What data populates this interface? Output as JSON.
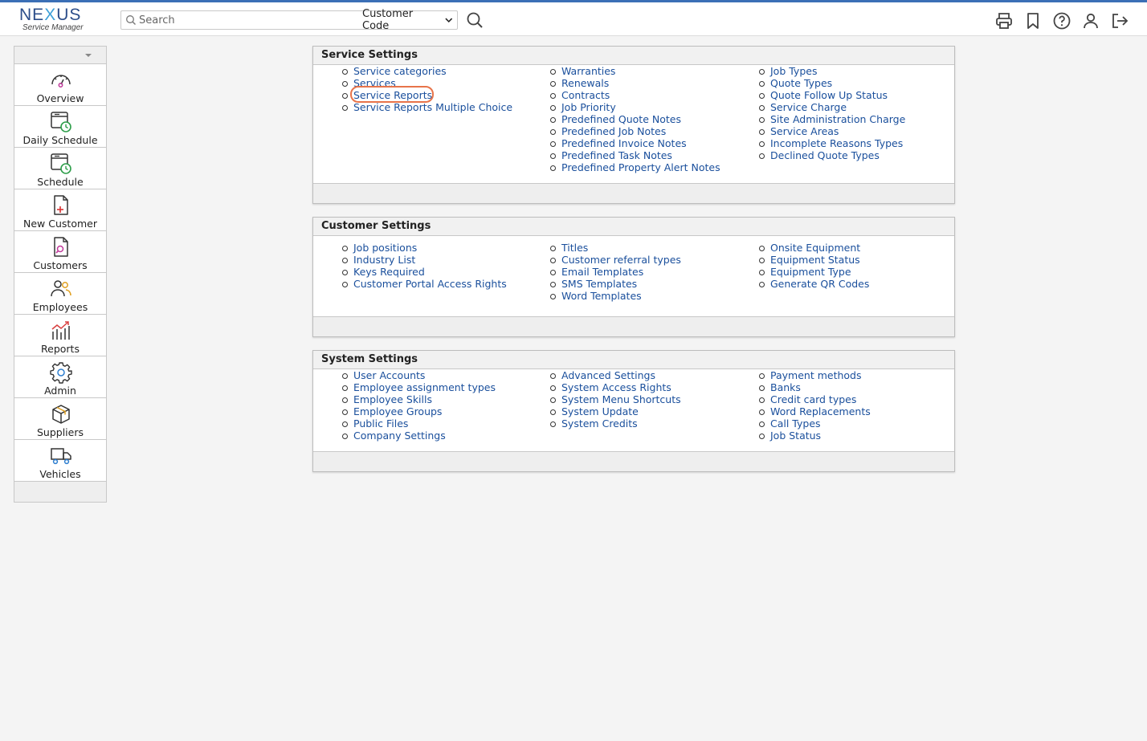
{
  "app": {
    "logo_main_a": "NE",
    "logo_main_x": "X",
    "logo_main_b": "US",
    "logo_sub": "Service Manager",
    "accent_color": "#3b6fb6"
  },
  "search": {
    "placeholder": "Search",
    "value": "",
    "type_selected": "Customer Code"
  },
  "toolbar": {
    "icons": [
      "print-icon",
      "bookmark-icon",
      "help-icon",
      "user-icon",
      "logout-icon"
    ]
  },
  "sidebar": {
    "items": [
      {
        "label": "Overview",
        "icon": "dashboard-gauge-icon"
      },
      {
        "label": "Daily Schedule",
        "icon": "calendar-clock-icon"
      },
      {
        "label": "Schedule",
        "icon": "calendar-clock-icon"
      },
      {
        "label": "New Customer",
        "icon": "add-document-icon"
      },
      {
        "label": "Customers",
        "icon": "search-document-icon"
      },
      {
        "label": "Employees",
        "icon": "users-icon"
      },
      {
        "label": "Reports",
        "icon": "chart-icon"
      },
      {
        "label": "Admin",
        "icon": "gear-icon"
      },
      {
        "label": "Suppliers",
        "icon": "box-icon"
      },
      {
        "label": "Vehicles",
        "icon": "truck-icon"
      }
    ]
  },
  "panels": {
    "service": {
      "title": "Service Settings",
      "col1": [
        "Service categories",
        "Services",
        "Service Reports",
        "Service Reports Multiple Choice"
      ],
      "col2": [
        "Warranties",
        "Renewals",
        "Contracts",
        "Job Priority",
        "Predefined Quote Notes",
        "Predefined Job Notes",
        "Predefined Invoice Notes",
        "Predefined Task Notes",
        "Predefined Property Alert Notes"
      ],
      "col3": [
        "Job Types",
        "Quote Types",
        "Quote Follow Up Status",
        "Service Charge",
        "Site Administration Charge",
        "Service Areas",
        "Incomplete Reasons Types",
        "Declined Quote Types"
      ]
    },
    "customer": {
      "title": "Customer Settings",
      "col1": [
        "Job positions",
        "Industry List",
        "Keys Required",
        "Customer Portal Access Rights"
      ],
      "col2": [
        "Titles",
        "Customer referral types",
        "Email Templates",
        "SMS Templates",
        "Word Templates"
      ],
      "col3": [
        "Onsite Equipment",
        "Equipment Status",
        "Equipment Type",
        "Generate QR Codes"
      ]
    },
    "system": {
      "title": "System Settings",
      "col1": [
        "User Accounts",
        "Employee assignment types",
        "Employee Skills",
        "Employee Groups",
        "Public Files",
        "Company Settings"
      ],
      "col2": [
        "Advanced Settings",
        "System Access Rights",
        "System Menu Shortcuts",
        "System Update",
        "System Credits"
      ],
      "col3": [
        "Payment methods",
        "Banks",
        "Credit card types",
        "Word Replacements",
        "Call Types",
        "Job Status"
      ]
    }
  }
}
